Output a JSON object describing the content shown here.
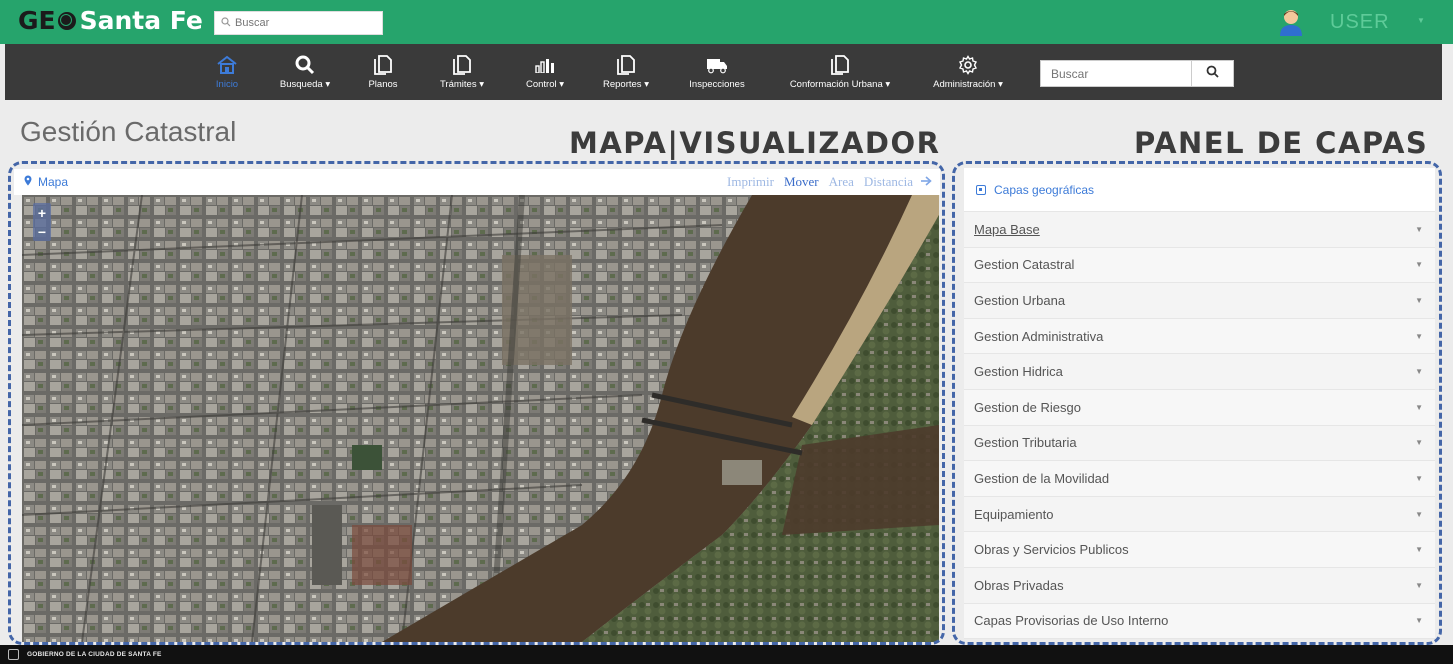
{
  "header": {
    "logo_geo": "GE",
    "logo_city": "Santa Fe",
    "search_placeholder": "Buscar",
    "user_label": "USER"
  },
  "nav": {
    "items": [
      {
        "label": "Inicio",
        "caret": false,
        "icon": "home-icon"
      },
      {
        "label": "Busqueda",
        "caret": true,
        "icon": "search-icon"
      },
      {
        "label": "Planos",
        "caret": false,
        "icon": "document-icon"
      },
      {
        "label": "Trámites",
        "caret": true,
        "icon": "document-icon"
      },
      {
        "label": "Control",
        "caret": true,
        "icon": "bar-chart-icon"
      },
      {
        "label": "Reportes",
        "caret": true,
        "icon": "document-icon"
      },
      {
        "label": "Inspecciones",
        "caret": false,
        "icon": "truck-icon"
      },
      {
        "label": "Conformación Urbana",
        "caret": true,
        "icon": "document-icon"
      },
      {
        "label": "Administración",
        "caret": true,
        "icon": "gear-icon"
      }
    ],
    "search_placeholder": "Buscar"
  },
  "page": {
    "title": "Gestión Catastral",
    "map_label": "MAPA|VISUALIZADOR",
    "panel_label": "PANEL DE CAPAS"
  },
  "map": {
    "title": "Mapa",
    "tools": [
      "Imprimir",
      "Mover",
      "Area",
      "Distancia"
    ],
    "active_tool": "Mover",
    "zoom_in": "+",
    "zoom_out": "−"
  },
  "layers": {
    "title": "Capas geográficas",
    "items": [
      "Mapa Base",
      "Gestion Catastral",
      "Gestion Urbana",
      "Gestion Administrativa",
      "Gestion Hidrica",
      "Gestion de Riesgo",
      "Gestion Tributaria",
      "Gestion de la Movilidad",
      "Equipamiento",
      "Obras y Servicios Publicos",
      "Obras Privadas",
      "Capas Provisorias de Uso Interno"
    ]
  },
  "footer": {
    "text": "GOBIERNO DE LA CIUDAD DE SANTA FE"
  },
  "colors": {
    "topbar": "#26a46c",
    "navbar": "#3a3a3a",
    "accent": "#3d7bd8",
    "river": "#4a3a2a"
  }
}
